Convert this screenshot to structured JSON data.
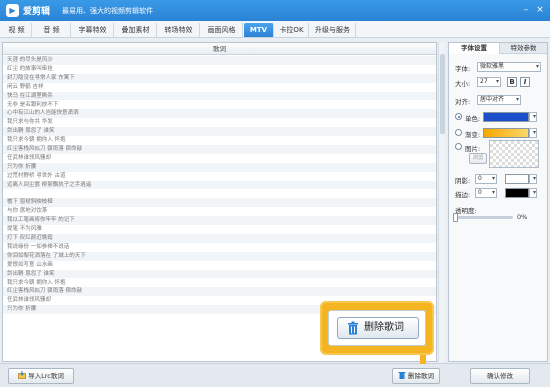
{
  "app": {
    "name": "爱剪辑",
    "slogan": "最易用、强大的视频剪辑软件",
    "icon": "app-logo-icon"
  },
  "window_controls": {
    "minimize": "–",
    "close": "×"
  },
  "menu": {
    "tabs": [
      {
        "label": "视 频",
        "active": false
      },
      {
        "label": "音 频",
        "active": false
      },
      {
        "label": "字幕特效",
        "active": false
      },
      {
        "label": "叠加素材",
        "active": false
      },
      {
        "label": "转场特效",
        "active": false
      },
      {
        "label": "画面风格",
        "active": false
      },
      {
        "label": "MTV",
        "active": true
      },
      {
        "label": "卡拉OK",
        "active": false
      },
      {
        "label": "升级与服务",
        "active": false
      }
    ]
  },
  "lyrics": {
    "header": "歌词",
    "rows": [
      "天涯 的尽头是风沙",
      "红尘 的故事叫牵挂",
      "封刀隐没在寻常人家 东篱下",
      "闲云 野鹤 吉祥",
      "快马 在江湖里撕杀",
      "无非 是名跟利放不下",
      "心中有江山的人岂能快意潇洒",
      "我只求与你共 华发",
      "剑出鞘 恩怨了 谁笑",
      "我只求今朝 拥你入 怀抱",
      "红尘客栈风似刀 骤雨落 宿命敲",
      "任武林谁领风骚却",
      "只为你 折腰",
      "过荒村野桥 寻世外 古道",
      "远离人间尘嚣 柳絮飘执子之手逍遥",
      "",
      "檐下 窗棂斜映枝桠",
      "与你 席地对饮茶",
      "我以工笔画将你牢牢 的记下",
      "提笔 不为风雅",
      "灯下 叹红颜近晚霞",
      "我说缘份 一如参禅不说话",
      "你泪如梨花洒落在 了城上的天下",
      "爱恨如写意 山水画",
      "剑出鞘 恩怨了 谁笑",
      "我只求今朝 拥你入 怀抱",
      "红尘客栈风似刀 骤雨落 宿命敲",
      "任武林谁领风骚却",
      "只为你 折腰"
    ]
  },
  "bottom_bar": {
    "import_button": "导入Lrc歌词",
    "delete_button": "删除歌词",
    "confirm_button": "确认修改"
  },
  "callout": {
    "label": "删除歌词"
  },
  "settings": {
    "tabs": [
      {
        "label": "字体设置",
        "active": true
      },
      {
        "label": "特效参数",
        "active": false
      }
    ],
    "font_label": "字体:",
    "font_value": "微软雅黑",
    "size_label": "大小:",
    "size_value": "27",
    "bold": "B",
    "italic": "I",
    "align_label": "对齐:",
    "align_value": "居中对齐",
    "color_mode": {
      "single_label": "单色:",
      "gradient_label": "渐变:",
      "image_label": "图片:",
      "selected": "single",
      "single_color": "#1a4fc9",
      "gradient_from": "#f7a600",
      "gradient_to": "#fbd96a"
    },
    "browse_button": "浏览",
    "shadow_label": "阴影:",
    "shadow_value": "0",
    "shadow_color": "#ffffff",
    "stroke_label": "描边:",
    "stroke_value": "0",
    "stroke_color": "#000000",
    "opacity_label": "透明度:",
    "opacity_value": "0%",
    "opacity_fraction": 0.0
  },
  "colors": {
    "accent": "#2a83d6",
    "highlight": "#f5b520"
  }
}
